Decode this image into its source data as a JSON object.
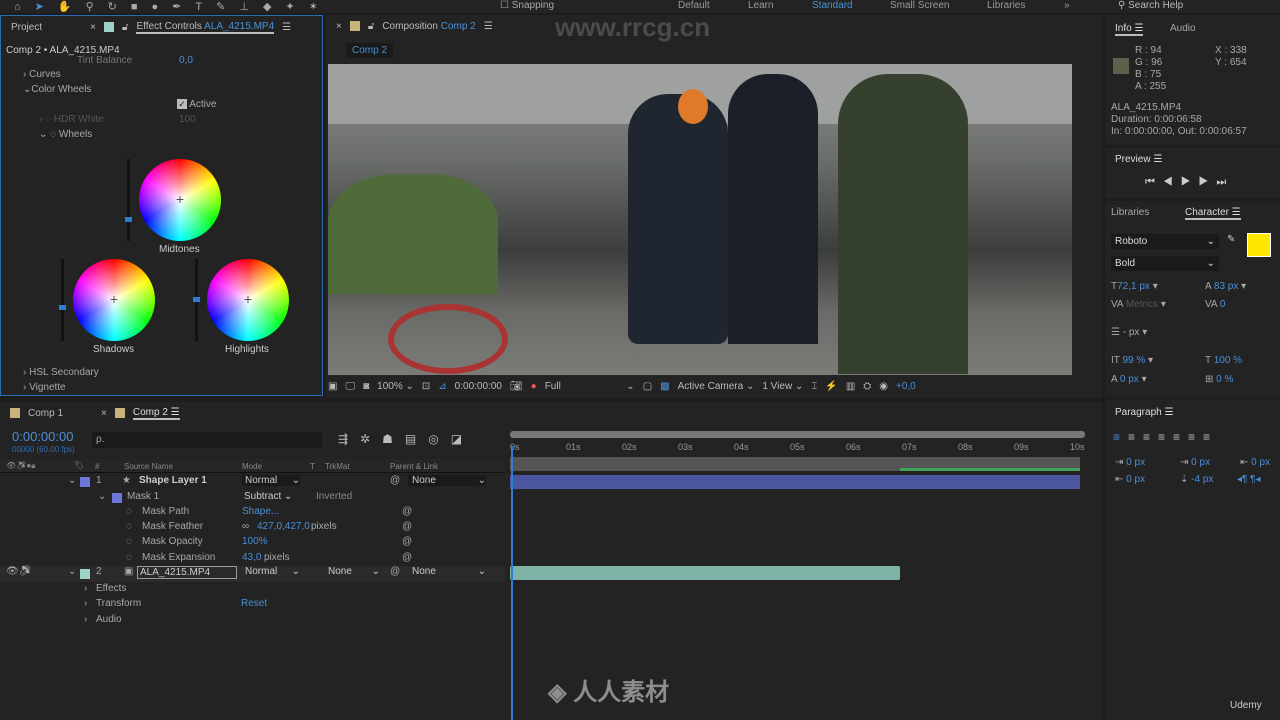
{
  "toolbar": {
    "snapping": "Snapping",
    "workspaces": [
      "Default",
      "Learn",
      "Standard",
      "Small Screen",
      "Libraries"
    ],
    "more": "»",
    "search_help": "Search Help"
  },
  "watermark": "www.rrcg.cn",
  "project_tab": "Project",
  "effect_controls": {
    "tab_label": "Effect Controls",
    "tab_file": "ALA_4215.MP4",
    "breadcrumb": "Comp 2 • ALA_4215.MP4",
    "tint_balance": "Tint Balance",
    "tint_value": "0,0",
    "curves": "Curves",
    "color_wheels": "Color Wheels",
    "active": "Active",
    "hdr_white": "HDR White",
    "hdr_value": "100",
    "wheels": "Wheels",
    "midtones": "Midtones",
    "shadows": "Shadows",
    "highlights": "Highlights",
    "hsl_secondary": "HSL Secondary",
    "vignette": "Vignette"
  },
  "composition": {
    "tab_label": "Composition",
    "tab_comp": "Comp 2",
    "sub_tab": "Comp 2",
    "zoom": "100%",
    "timecode": "0:00:00:00",
    "resolution": "Full",
    "camera": "Active Camera",
    "views": "1 View",
    "exposure": "+0,0"
  },
  "info": {
    "tab": "Info",
    "audio_tab": "Audio",
    "r": "R : 94",
    "g": "G : 96",
    "b": "B : 75",
    "a": "A : 255",
    "x": "X : 338",
    "y": "Y : 654",
    "swatch": "#5e604b",
    "file": "ALA_4215.MP4",
    "duration": "Duration: 0:00:06:58",
    "inout": "In: 0:00:00:00, Out: 0:00:06:57"
  },
  "preview": {
    "title": "Preview"
  },
  "character": {
    "libraries_tab": "Libraries",
    "tab": "Character",
    "font": "Roboto",
    "style": "Bold",
    "fill_color": "#ffe600",
    "size": "72,1 px",
    "leading": "83 px",
    "kerning": "Metrics",
    "tracking": "0",
    "stroke": "- px",
    "vscale": "99 %",
    "hscale": "100 %",
    "baseline": "0 px",
    "tsume": "0 %"
  },
  "paragraph": {
    "title": "Paragraph",
    "indent_left": "0 px",
    "indent_first": "0 px",
    "indent_right": "0 px",
    "space_before": "0 px",
    "space_after": "-4 px"
  },
  "timeline": {
    "tabs": [
      "Comp 1",
      "Comp 2"
    ],
    "timecode": "0:00:00:00",
    "fps": "00000 (60.00 fps)",
    "search_placeholder": "ρ.",
    "headers": {
      "num": "#",
      "source": "Source Name",
      "mode": "Mode",
      "t": "T",
      "trkmat": "TrkMat",
      "parent": "Parent & Link"
    },
    "ruler": [
      "0s",
      "01s",
      "02s",
      "03s",
      "04s",
      "05s",
      "06s",
      "07s",
      "08s",
      "09s",
      "10s"
    ],
    "layers": [
      {
        "num": "1",
        "name": "Shape Layer 1",
        "mode": "Normal",
        "parent": "None",
        "color": "#6b78d8"
      },
      {
        "num": "2",
        "name": "ALA_4215.MP4",
        "mode": "Normal",
        "trkmat": "None",
        "parent": "None",
        "color": "#9fd3c7"
      }
    ],
    "mask": {
      "name": "Mask 1",
      "mode": "Subtract",
      "inverted": "Inverted",
      "path": "Mask Path",
      "path_val": "Shape...",
      "feather": "Mask Feather",
      "feather_val": "427,0,427,0",
      "feather_unit": "pixels",
      "opacity": "Mask Opacity",
      "opacity_val": "100%",
      "expansion": "Mask Expansion",
      "expansion_val": "43,0",
      "expansion_unit": "pixels"
    },
    "props": {
      "effects": "Effects",
      "transform": "Transform",
      "reset": "Reset",
      "audio": "Audio"
    }
  },
  "brand": "Udemy"
}
